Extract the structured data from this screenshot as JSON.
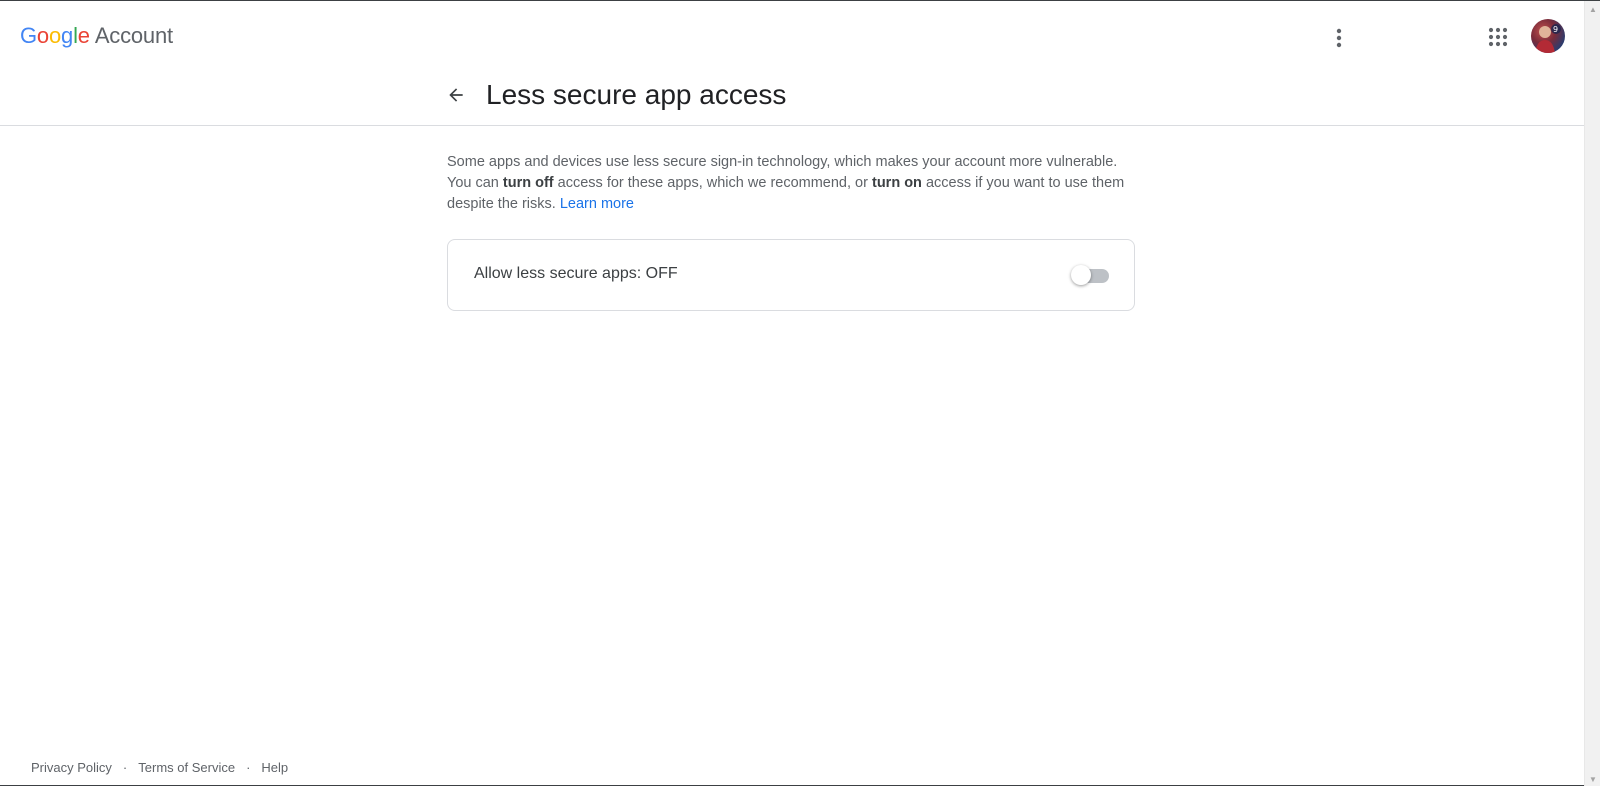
{
  "header": {
    "brand_part_1": "G",
    "brand_part_2": "o",
    "brand_part_3": "o",
    "brand_part_4": "g",
    "brand_part_5": "l",
    "brand_part_6": "e",
    "brand_suffix": "Account",
    "more_icon": "more-vert-icon",
    "apps_icon": "apps-grid-icon",
    "avatar_icon": "profile-avatar"
  },
  "title_row": {
    "back_icon": "arrow-back-icon",
    "title": "Less secure app access"
  },
  "description": {
    "part1": "Some apps and devices use less secure sign-in technology, which makes your account more vulnerable. You can ",
    "bold1": "turn off",
    "part2": " access for these apps, which we recommend, or ",
    "bold2": "turn on",
    "part3": " access if you want to use them despite the risks. ",
    "link": "Learn more"
  },
  "setting": {
    "label": "Allow less secure apps: OFF",
    "enabled": false
  },
  "footer": {
    "links": [
      "Privacy Policy",
      "Terms of Service",
      "Help"
    ],
    "separator": "·"
  },
  "colors": {
    "google_blue": "#4285F4",
    "google_red": "#EA4335",
    "google_yellow": "#FBBC05",
    "google_green": "#34A853",
    "link_blue": "#1a73e8",
    "toggle_off_track": "#bdc1c6"
  }
}
